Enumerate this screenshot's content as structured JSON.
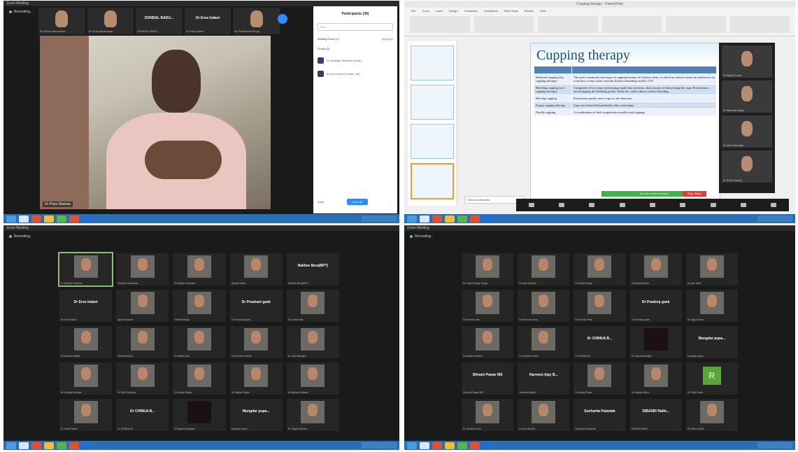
{
  "p1": {
    "window_title": "Zoom Meeting",
    "meeting_label": "Recording...",
    "strip": [
      {
        "type": "video",
        "caption": "Dr Akhila Narayanan"
      },
      {
        "type": "video",
        "caption": "Dr Vinay Bhatnagar"
      },
      {
        "type": "name",
        "name": "DONDAL RADU...",
        "caption": "DONDAL RADU..."
      },
      {
        "type": "name",
        "name": "Dr Eros Indani",
        "caption": "Dr Eros Indani"
      },
      {
        "type": "video",
        "caption": "Dr Padmavati Singh"
      }
    ],
    "speaker_caption": "Dr Priya Sharma",
    "participants": {
      "header": "Participants (39)",
      "search_placeholder": "Find",
      "waiting_label": "Waiting Room (1)",
      "waiting_action": "Message",
      "group_label": "Group (2)",
      "people": [
        "Dr Niranjan Tarkunde (Host)",
        "Zoom Guest (Co-host, me)"
      ],
      "footer_left": "Invite",
      "footer_btn": "Mute All",
      "footer_right": "..."
    }
  },
  "p2": {
    "window_title": "Cupping therapy - PowerPoint",
    "tabs": [
      "File",
      "Home",
      "Insert",
      "Design",
      "Transitions",
      "Animations",
      "Slide Show",
      "Review",
      "View"
    ],
    "slide_title": "Cupping therapy",
    "rows": [
      [
        "Retained cupping (dry cupping therapy)",
        "The most commonly used type of cupping therapy in Chinese clinic, in which no blood comes out and leaves no scratches; it may cause vascular flushes remaining visible. CFS"
      ],
      [
        "Bleeding cupping (wet cupping therapy)",
        "Composed of two steps: performing small skin incisions, then suction of blood using the cups. Practitioners avoid tapping the bleeding points. Study the collect data to reduce bleeding."
      ],
      [
        "Moving cupping",
        "Practitioner gently move cups to one direction"
      ],
      [
        "Empty cupping therapy",
        "Cups are removed immediately after suctioning"
      ],
      [
        "Needle cupping",
        "A combination of both acupuncture needles and cupping"
      ]
    ],
    "notes": "Click to add notes",
    "share_bar": "You are screen sharing",
    "stop_share": "Stop Share",
    "videos": [
      "Dr Rajesh Kumar",
      "Dr Harvinder Singh",
      "Dr Ashok Shendge",
      "Dr Sunil Chandra"
    ]
  },
  "p3": {
    "window_title": "Zoom Meeting",
    "meeting_label": "Recording...",
    "tiles": [
      {
        "t": "video",
        "c": "Dr Manish Chauhan",
        "hi": true
      },
      {
        "t": "video",
        "c": "Shekhar Karmakar"
      },
      {
        "t": "video",
        "c": "Dr Madan Chandra"
      },
      {
        "t": "video",
        "c": "Saurav Dutta"
      },
      {
        "t": "name",
        "n": "Rakhee Bera(BPT)",
        "c": "Rakhee Bera(BPT)"
      },
      {
        "t": "name",
        "n": "Dr Eros Indani",
        "c": "Dr Eros Indani"
      },
      {
        "t": "video",
        "c": "Ajay Parashar"
      },
      {
        "t": "video",
        "c": "Sheetal Singh"
      },
      {
        "t": "name",
        "n": "Dr Prashant gaek",
        "c": "Dr Prashant gaek"
      },
      {
        "t": "video",
        "c": "Dr Kavita Nair"
      },
      {
        "t": "video",
        "c": "Dr Naresh Mallick"
      },
      {
        "t": "video",
        "c": "Sheetal Karva"
      },
      {
        "t": "video",
        "c": "Dr Nilima Das"
      },
      {
        "t": "video",
        "c": "Dr Ramesh Kumar"
      },
      {
        "t": "video",
        "c": "Dr Jyoti Mahajan"
      },
      {
        "t": "video",
        "c": "Dr Deepak Kanojia"
      },
      {
        "t": "video",
        "c": "Dr Ravi Shankar"
      },
      {
        "t": "video",
        "c": "Dr Pooja Verma"
      },
      {
        "t": "video",
        "c": "Dr Sanjay Gupta"
      },
      {
        "t": "video",
        "c": "Dr Mohan Kulkarni"
      },
      {
        "t": "video",
        "c": "Dr Sunil Pawar"
      },
      {
        "t": "name",
        "n": "Dr CHINUA B...",
        "c": "Dr CHINUA B..."
      },
      {
        "t": "dark",
        "c": "Dr Sapna Mahajan"
      },
      {
        "t": "name",
        "n": "Mungdar pupa...",
        "c": "Mungdar pupa..."
      },
      {
        "t": "video",
        "c": "Dr Sagar Sharma"
      }
    ]
  },
  "p4": {
    "window_title": "Zoom Meeting",
    "meeting_label": "Recording...",
    "tiles": [
      {
        "t": "video",
        "c": "Dr Vinod Kumar Singh"
      },
      {
        "t": "video",
        "c": "Dr Alok Sharma"
      },
      {
        "t": "video",
        "c": "Dr Harish Singh"
      },
      {
        "t": "video",
        "c": "Dr Mukesh Bhat"
      },
      {
        "t": "video",
        "c": "Dr Anil Joshi"
      },
      {
        "t": "video",
        "c": "Dr Rakesh Jain"
      },
      {
        "t": "video",
        "c": "Dr Narendra Rao"
      },
      {
        "t": "video",
        "c": "Dr Suresh Pillai"
      },
      {
        "t": "name",
        "n": "Dr Pradeep gaek",
        "c": "Dr Pradeep gaek"
      },
      {
        "t": "video",
        "c": "Dr Vijay Kumar"
      },
      {
        "t": "video",
        "c": "Dr Ashish Pandey"
      },
      {
        "t": "video",
        "c": "Dr Deepak Yadav"
      },
      {
        "t": "name",
        "n": "Dr CHINUA B...",
        "c": "Dr CHINUA B..."
      },
      {
        "t": "dark",
        "c": "Dr Sapna Mahajan"
      },
      {
        "t": "name",
        "n": "Mungdar pupa...",
        "c": "Mungdar pupa..."
      },
      {
        "t": "name",
        "n": "Shivani Pawar MS",
        "c": "Shivani Pawar MS"
      },
      {
        "t": "name",
        "n": "Harmeet Ajay B...",
        "c": "Harmeet Ajay B..."
      },
      {
        "t": "video",
        "c": "Dr Manoj Tiwari"
      },
      {
        "t": "video",
        "c": "Dr Gaurav Bose"
      },
      {
        "t": "letter",
        "l": "R",
        "c": "Dr Rohit Dutta"
      },
      {
        "t": "video",
        "c": "Dr Sameer Khan"
      },
      {
        "t": "video",
        "c": "Dr Amit Bhosle"
      },
      {
        "t": "name",
        "n": "Sucharita Palaniak",
        "c": "Sucharita Palaniak"
      },
      {
        "t": "name",
        "n": "DIBASRI Rathi...",
        "c": "DIBASRI Rathi..."
      },
      {
        "t": "video",
        "c": "Dr Kishor Mane"
      }
    ]
  }
}
